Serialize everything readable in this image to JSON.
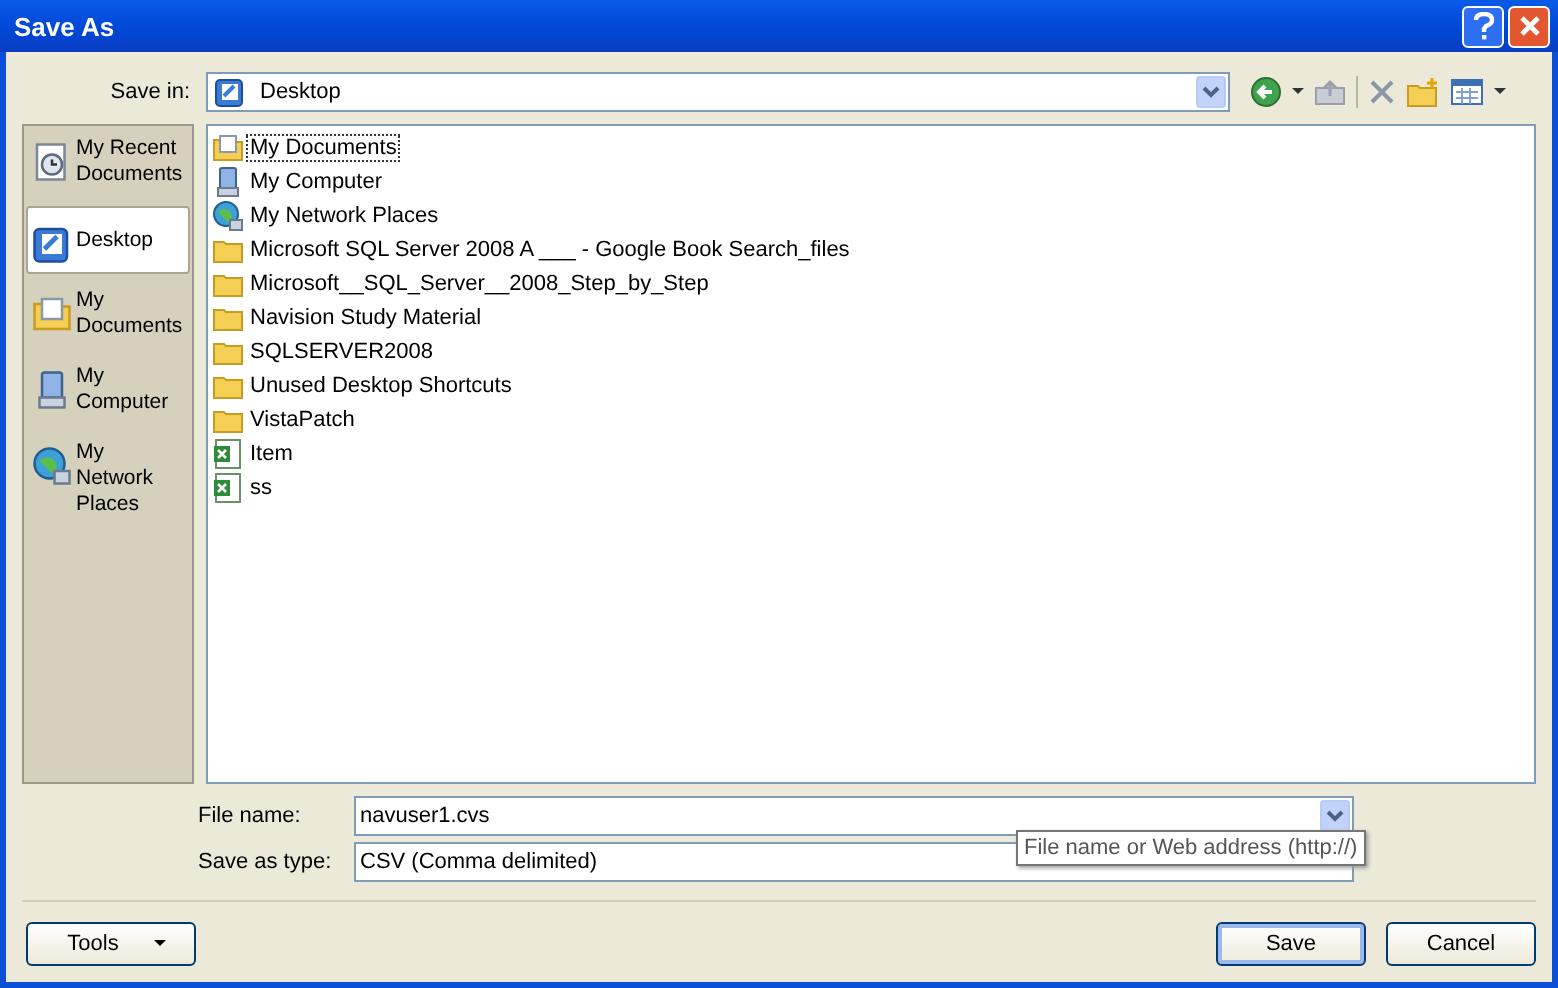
{
  "window": {
    "title": "Save As"
  },
  "save_in": {
    "label": "Save in:",
    "value": "Desktop"
  },
  "places": [
    {
      "label": "My Recent Documents",
      "kind": "recent",
      "selected": false
    },
    {
      "label": "Desktop",
      "kind": "desktop",
      "selected": true
    },
    {
      "label": "My Documents",
      "kind": "documents",
      "selected": false
    },
    {
      "label": "My Computer",
      "kind": "computer",
      "selected": false
    },
    {
      "label": "My Network Places",
      "kind": "network",
      "selected": false
    }
  ],
  "files": [
    {
      "name": "My Documents",
      "kind": "documents",
      "selected": true
    },
    {
      "name": "My Computer",
      "kind": "computer",
      "selected": false
    },
    {
      "name": "My Network Places",
      "kind": "network",
      "selected": false
    },
    {
      "name": "Microsoft SQL Server 2008 A ___ - Google Book Search_files",
      "kind": "folder",
      "selected": false
    },
    {
      "name": "Microsoft__SQL_Server__2008_Step_by_Step",
      "kind": "folder",
      "selected": false
    },
    {
      "name": "Navision Study Material",
      "kind": "folder",
      "selected": false
    },
    {
      "name": "SQLSERVER2008",
      "kind": "folder",
      "selected": false
    },
    {
      "name": "Unused Desktop Shortcuts",
      "kind": "folder",
      "selected": false
    },
    {
      "name": "VistaPatch",
      "kind": "folder",
      "selected": false
    },
    {
      "name": "Item",
      "kind": "excel",
      "selected": false
    },
    {
      "name": "ss",
      "kind": "excel",
      "selected": false
    }
  ],
  "file_name": {
    "label": "File name:",
    "value": "navuser1.cvs"
  },
  "save_as_type": {
    "label": "Save as type:",
    "value": "CSV (Comma delimited)"
  },
  "tooltip": "File name or Web address (http://)",
  "buttons": {
    "tools": "Tools",
    "save": "Save",
    "cancel": "Cancel"
  }
}
